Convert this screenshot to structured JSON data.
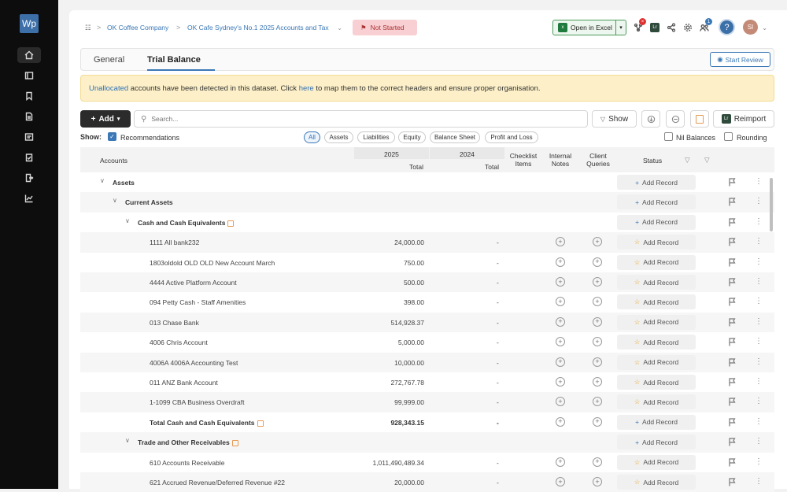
{
  "app": {
    "logo": "Wp"
  },
  "sidebar": {
    "items": [
      {
        "icon": "home-icon"
      },
      {
        "icon": "sheet-icon"
      },
      {
        "icon": "bookmark-icon"
      },
      {
        "icon": "document-icon"
      },
      {
        "icon": "list-icon"
      },
      {
        "icon": "clipboard-check-icon"
      },
      {
        "icon": "export-icon"
      },
      {
        "icon": "chart-icon"
      }
    ]
  },
  "header": {
    "breadcrumb": [
      "OK Coffee Company",
      "OK Cafe Sydney's No.1 2025 Accounts and Tax"
    ],
    "status": "Not Started",
    "excel_label": "Open in Excel",
    "notif_count": "1",
    "avatar": "SI",
    "help": "?"
  },
  "tabs": [
    {
      "label": "General"
    },
    {
      "label": "Trial Balance"
    }
  ],
  "start_review": "Start Review",
  "banner": {
    "link1": "Unallocated",
    "text1": " accounts have been detected in this dataset. Click ",
    "link2": "here",
    "text2": " to map them to the correct headers and ensure proper organisation."
  },
  "toolbar": {
    "add": "Add",
    "search_placeholder": "Search...",
    "show": "Show",
    "reimport": "Reimport"
  },
  "filters": {
    "show_label": "Show:",
    "recommendations": "Recommendations",
    "chips": [
      "All",
      "Assets",
      "Liabilities",
      "Equity",
      "Balance Sheet",
      "Profit and Loss"
    ],
    "nil_balances": "Nil Balances",
    "rounding": "Rounding"
  },
  "table": {
    "headers": {
      "accounts": "Accounts",
      "y2025": "2025",
      "y2024": "2024",
      "total": "Total",
      "checklist": "Checklist Items",
      "notes": "Internal Notes",
      "queries": "Client Queries",
      "status": "Status"
    },
    "add_record": "Add Record",
    "rows": [
      {
        "type": "group",
        "level": 0,
        "name": "Assets",
        "v2025": "",
        "v2024": ""
      },
      {
        "type": "group",
        "level": 1,
        "name": "Current Assets",
        "v2025": "",
        "v2024": ""
      },
      {
        "type": "group",
        "level": 2,
        "name": "Cash and Cash Equivalents",
        "v2025": "",
        "v2024": ""
      },
      {
        "type": "acct",
        "name": "1111 All bank232",
        "v2025": "24,000.00",
        "v2024": "-"
      },
      {
        "type": "acct",
        "name": "1803oldold OLD OLD New Account March",
        "v2025": "750.00",
        "v2024": "-"
      },
      {
        "type": "acct",
        "name": "4444 Active Platform Account",
        "v2025": "500.00",
        "v2024": "-"
      },
      {
        "type": "acct",
        "name": "094 Petty Cash - Staff Amenities",
        "v2025": "398.00",
        "v2024": "-"
      },
      {
        "type": "acct",
        "name": "013 Chase Bank",
        "v2025": "514,928.37",
        "v2024": "-"
      },
      {
        "type": "acct",
        "name": "4006 Chris Account",
        "v2025": "5,000.00",
        "v2024": "-"
      },
      {
        "type": "acct",
        "name": "4006A 4006A Accounting Test",
        "v2025": "10,000.00",
        "v2024": "-"
      },
      {
        "type": "acct",
        "name": "011 ANZ Bank Account",
        "v2025": "272,767.78",
        "v2024": "-"
      },
      {
        "type": "acct",
        "name": "1-1099 CBA Business Overdraft",
        "v2025": "99,999.00",
        "v2024": "-"
      },
      {
        "type": "total",
        "name": "Total Cash and Cash Equivalents",
        "v2025": "928,343.15",
        "v2024": "-"
      },
      {
        "type": "group",
        "level": 2,
        "name": "Trade and Other Receivables",
        "v2025": "",
        "v2024": ""
      },
      {
        "type": "acct",
        "name": "610 Accounts Receivable",
        "v2025": "1,011,490,489.34",
        "v2024": "-"
      },
      {
        "type": "acct",
        "name": "621 Accrued Revenue/Deferred Revenue #22",
        "v2025": "20,000.00",
        "v2024": "-"
      }
    ]
  }
}
